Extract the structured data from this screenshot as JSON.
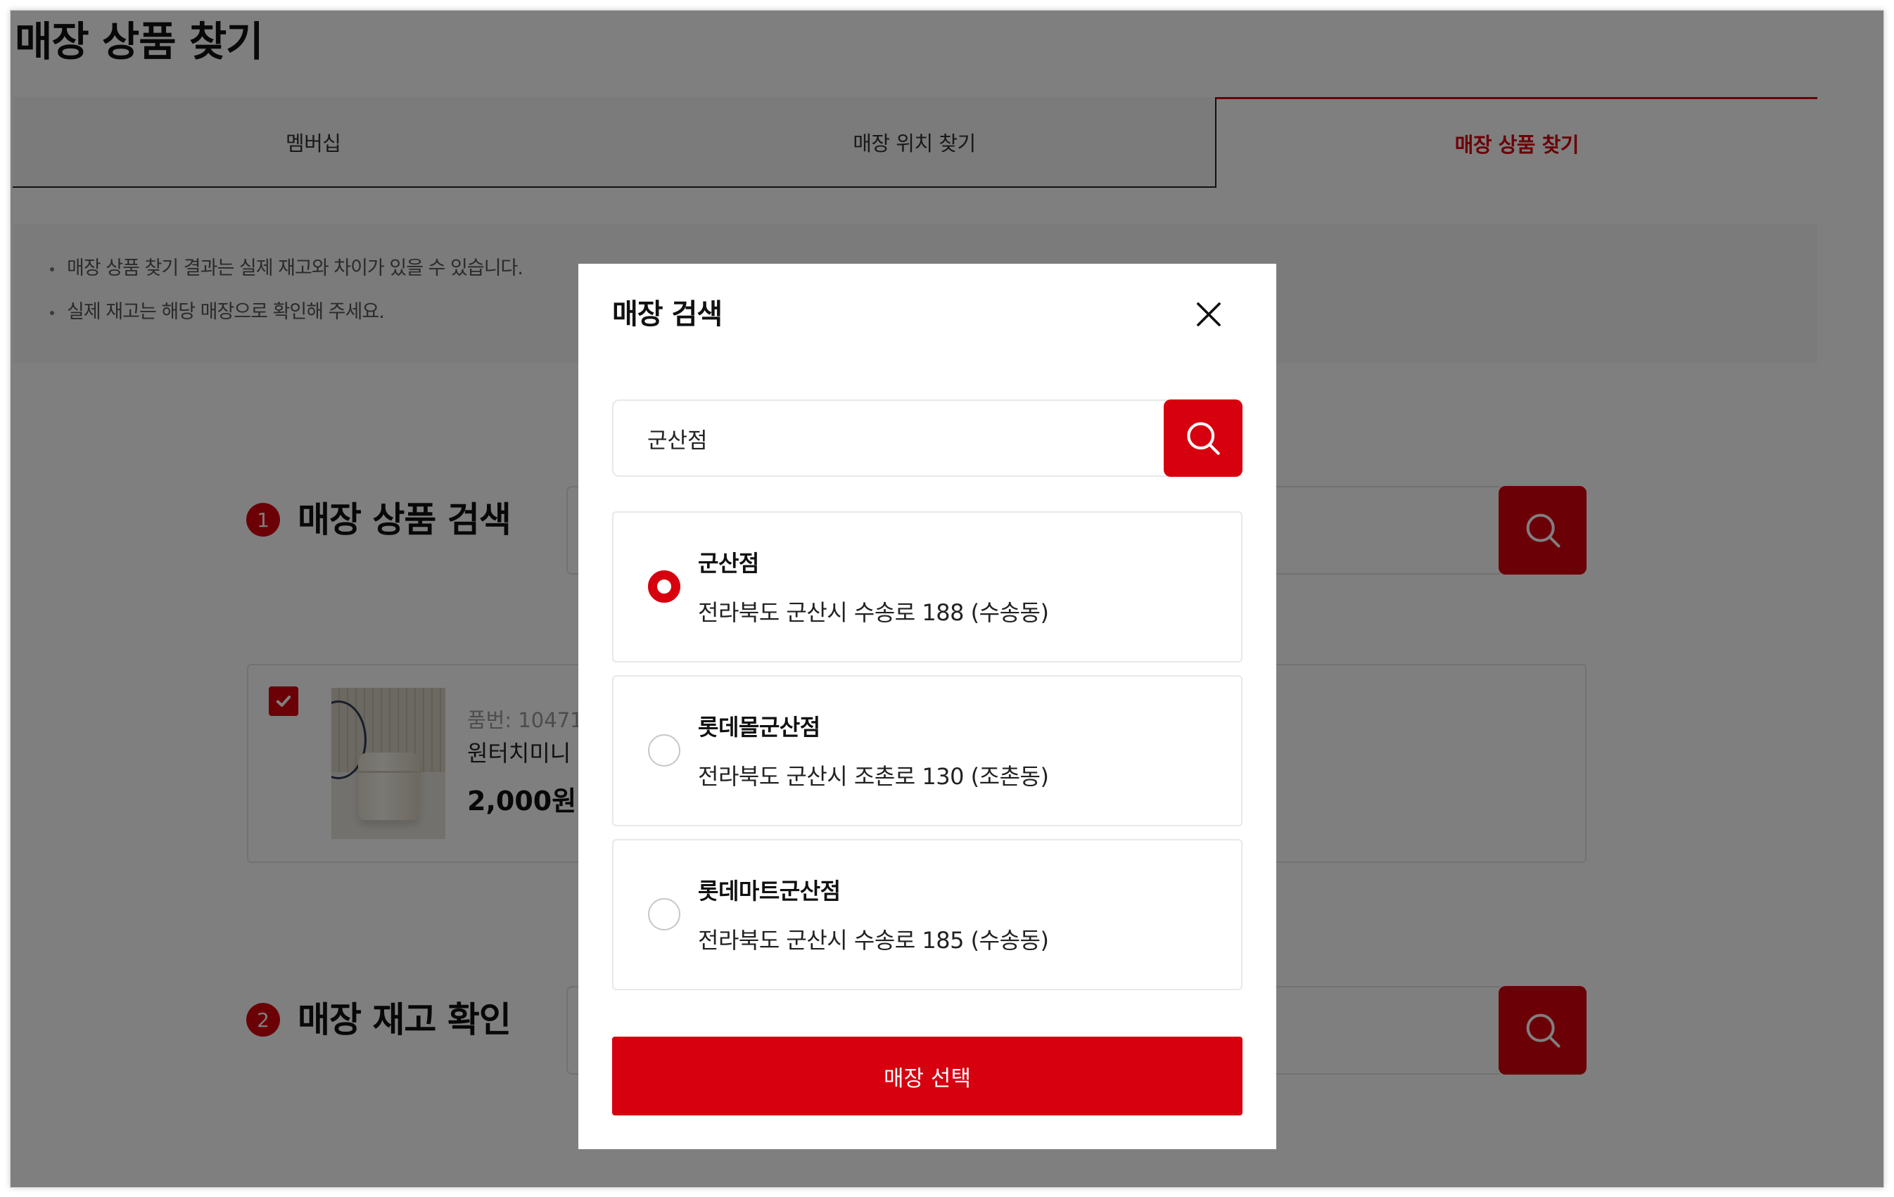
{
  "page": {
    "title": "매장 상품 찾기"
  },
  "tabs": [
    {
      "label": "멤버십",
      "active": false
    },
    {
      "label": "매장 위치 찾기",
      "active": false
    },
    {
      "label": "매장 상품 찾기",
      "active": true
    }
  ],
  "notice": {
    "items": [
      "매장 상품 찾기 결과는 실제 재고와 차이가 있을 수 있습니다.",
      "실제 재고는 해당 매장으로 확인해 주세요."
    ]
  },
  "sections": [
    {
      "number": "1",
      "title": "매장 상품 검색"
    },
    {
      "number": "2",
      "title": "매장 재고 확인"
    }
  ],
  "product": {
    "checked": true,
    "code": "품번: 10471",
    "name": "원터치미니",
    "price": "2,000원"
  },
  "modal": {
    "title": "매장 검색",
    "search": {
      "value": "군산점"
    },
    "results": [
      {
        "name": "군산점",
        "address": "전라북도 군산시 수송로 188 (수송동)"
      },
      {
        "name": "롯데몰군산점",
        "address": "전라북도 군산시 조촌로 130 (조촌동)"
      },
      {
        "name": "롯데마트군산점",
        "address": "전라북도 군산시 수송로 185 (수송동)"
      }
    ],
    "selected_index": 0,
    "confirm_label": "매장 선택"
  },
  "icons": {
    "search": "search-icon",
    "close": "close-icon",
    "check": "check-icon"
  },
  "colors": {
    "accent": "#d6000f",
    "overlay": "rgba(0,0,0,0.5)"
  }
}
